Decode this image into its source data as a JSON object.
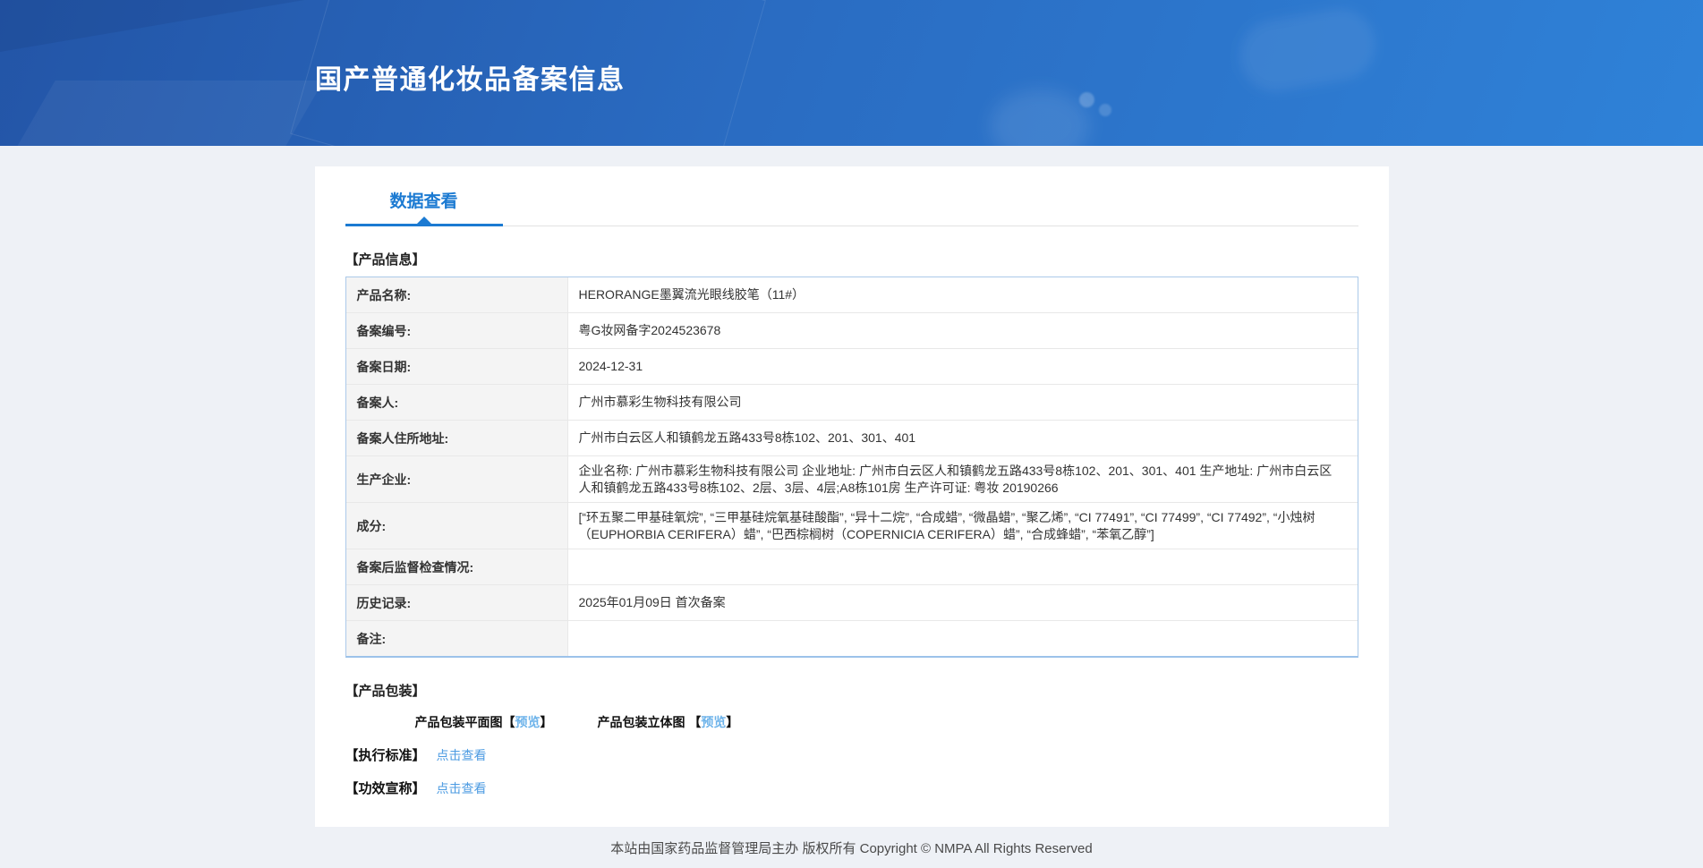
{
  "header": {
    "title": "国产普通化妆品备案信息"
  },
  "tabs": {
    "data_view": "数据查看"
  },
  "product_info": {
    "section_title": "【产品信息】",
    "rows": [
      {
        "label": "产品名称:",
        "value": "HERORANGE墨翼流光眼线胶笔（11#）"
      },
      {
        "label": "备案编号:",
        "value": "粤G妆网备字2024523678"
      },
      {
        "label": "备案日期:",
        "value": "2024-12-31"
      },
      {
        "label": "备案人:",
        "value": "广州市慕彩生物科技有限公司"
      },
      {
        "label": "备案人住所地址:",
        "value": "广州市白云区人和镇鹤龙五路433号8栋102、201、301、401"
      },
      {
        "label": "生产企业:",
        "value": "企业名称: 广州市慕彩生物科技有限公司 企业地址: 广州市白云区人和镇鹤龙五路433号8栋102、201、301、401 生产地址: 广州市白云区人和镇鹤龙五路433号8栋102、2层、3层、4层;A8栋101房 生产许可证: 粤妆 20190266"
      },
      {
        "label": "成分:",
        "value": "[“环五聚二甲基硅氧烷”, “三甲基硅烷氧基硅酸酯”, “异十二烷”, “合成蜡”, “微晶蜡”, “聚乙烯”, “CI 77491”, “CI 77499”, “CI 77492”, “小烛树（EUPHORBIA CERIFERA）蜡”, “巴西棕榈树（COPERNICIA CERIFERA）蜡”, “合成蜂蜡”, “苯氧乙醇”]"
      },
      {
        "label": "备案后监督检查情况:",
        "value": ""
      },
      {
        "label": "历史记录:",
        "value": "2025年01月09日 首次备案"
      },
      {
        "label": "备注:",
        "value": ""
      }
    ]
  },
  "packaging": {
    "section_title": "【产品包装】",
    "flat_label": "产品包装平面图",
    "stereo_label": "产品包装立体图 ",
    "bracket_open": "【",
    "bracket_close": "】",
    "preview_link": "预览"
  },
  "standards": {
    "label": "【执行标准】",
    "link": "点击查看"
  },
  "efficacy": {
    "label": "【功效宣称】",
    "link": "点击查看"
  },
  "footer": {
    "text": "本站由国家药品监督管理局主办 版权所有 Copyright © NMPA All Rights Reserved"
  },
  "colors": {
    "accent_blue": "#1b7ad2",
    "preview_link_blue": "#6db3ea",
    "click_link_blue": "#4c9be2",
    "header_gradient_start": "#2355a7",
    "header_gradient_end": "#2f82d8",
    "table_border_blue": "#abc9e9",
    "label_cell_bg": "#f4f4f4"
  }
}
